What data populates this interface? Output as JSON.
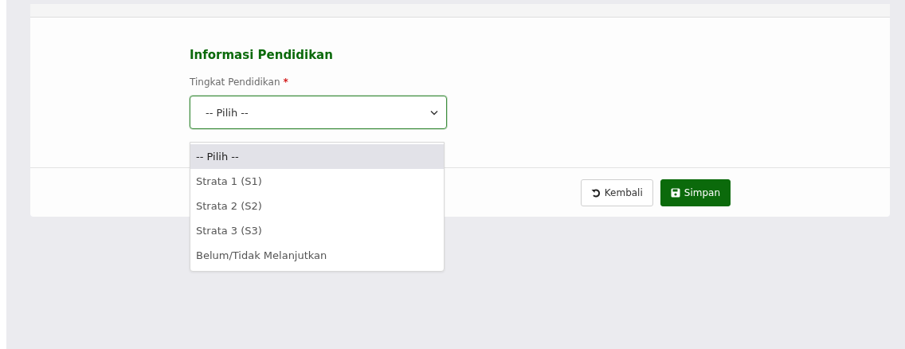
{
  "section": {
    "title": "Informasi Pendidikan"
  },
  "field": {
    "label": "Tingkat Pendidikan",
    "required_mark": "*",
    "value": "-- Pilih --",
    "expanded": true
  },
  "options": [
    {
      "label": "-- Pilih --",
      "selected": true
    },
    {
      "label": "Strata 1 (S1)",
      "selected": false
    },
    {
      "label": "Strata 2 (S2)",
      "selected": false
    },
    {
      "label": "Strata 3 (S3)",
      "selected": false
    },
    {
      "label": "Belum/Tidak Melanjutkan",
      "selected": false
    }
  ],
  "buttons": [
    {
      "label": "Kembali",
      "kind": "back"
    },
    {
      "label": "Simpan",
      "kind": "save"
    }
  ]
}
